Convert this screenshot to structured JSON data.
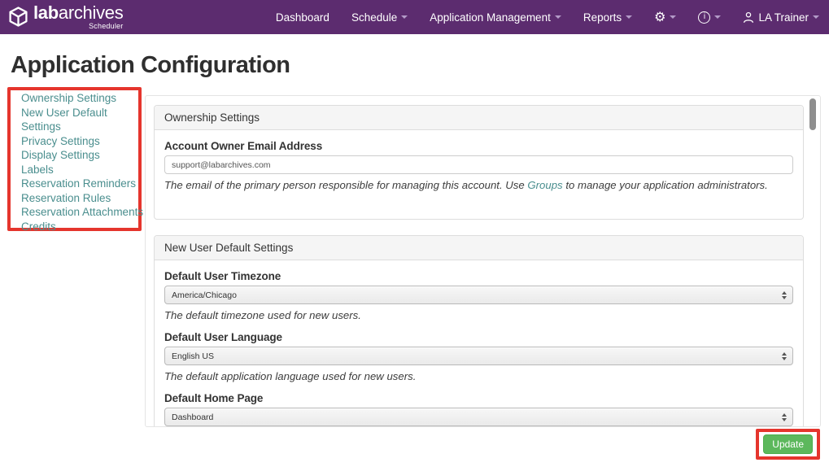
{
  "brand": {
    "name_bold": "lab",
    "name_rest": "archives",
    "subtitle": "Scheduler"
  },
  "nav": {
    "items": [
      {
        "label": "Dashboard",
        "dropdown": false
      },
      {
        "label": "Schedule",
        "dropdown": true
      },
      {
        "label": "Application Management",
        "dropdown": true
      },
      {
        "label": "Reports",
        "dropdown": true
      }
    ],
    "icons": [
      "gear-icon",
      "info-icon",
      "person-icon"
    ],
    "user_label": "LA Trainer"
  },
  "page": {
    "title": "Application Configuration"
  },
  "sidebar": {
    "items": [
      "Ownership Settings",
      "New User Default Settings",
      "Privacy Settings",
      "Display Settings",
      "Labels",
      "Reservation Reminders",
      "Reservation Rules",
      "Reservation Attachments",
      "Credits"
    ]
  },
  "sections": [
    {
      "title": "Ownership Settings",
      "fields": [
        {
          "label": "Account Owner Email Address",
          "type": "input",
          "value": "support@labarchives.com",
          "help_before": "The email of the primary person responsible for managing this account. Use ",
          "help_link": "Groups",
          "help_after": " to manage your application administrators."
        }
      ]
    },
    {
      "title": "New User Default Settings",
      "fields": [
        {
          "label": "Default User Timezone",
          "type": "select",
          "value": "America/Chicago",
          "help": "The default timezone used for new users."
        },
        {
          "label": "Default User Language",
          "type": "select",
          "value": "English US",
          "help": "The default application language used for new users."
        },
        {
          "label": "Default Home Page",
          "type": "select",
          "value": "Dashboard",
          "help": ""
        }
      ]
    }
  ],
  "footer": {
    "update_label": "Update"
  },
  "colors": {
    "navbar_purple": "#5c2c6f",
    "caret_lavender": "#b49bc8",
    "link_teal": "#4a8e8e",
    "highlight_red": "#e5352d",
    "button_green": "#5cb85c",
    "panel_header_bg": "#f5f5f5"
  }
}
